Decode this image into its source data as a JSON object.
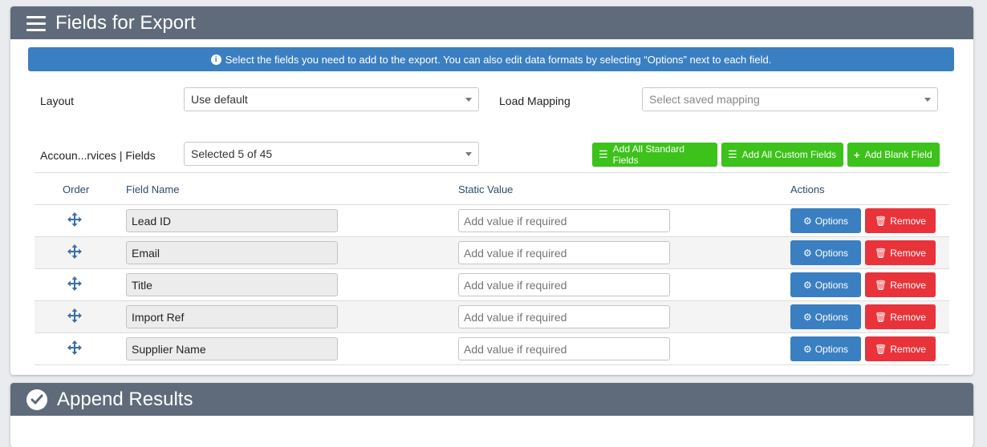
{
  "export_panel": {
    "title": "Fields for Export",
    "info": "Select the fields you need to add to the export. You can also edit data formats by selecting “Options” next to each field.",
    "layout_label": "Layout",
    "layout_value": "Use default",
    "load_mapping_label": "Load Mapping",
    "load_mapping_placeholder": "Select saved mapping",
    "fields_label": "Accoun...rvices | Fields",
    "fields_value": "Selected 5 of 45",
    "buttons": {
      "add_standard": "Add All Standard Fields",
      "add_custom": "Add All Custom Fields",
      "add_blank": "Add Blank Field"
    },
    "table": {
      "headers": {
        "order": "Order",
        "field_name": "Field Name",
        "static_value": "Static Value",
        "actions": "Actions"
      },
      "static_placeholder": "Add value if required",
      "options_label": "Options",
      "remove_label": "Remove",
      "rows": [
        {
          "field_name": "Lead ID"
        },
        {
          "field_name": "Email"
        },
        {
          "field_name": "Title"
        },
        {
          "field_name": "Import Ref"
        },
        {
          "field_name": "Supplier Name"
        }
      ]
    }
  },
  "append_panel": {
    "title": "Append Results"
  },
  "colors": {
    "header_bg": "#5f6b7a",
    "info_bg": "#3a7fc1",
    "green": "#3cc21a",
    "blue_button": "#3a7fc1",
    "red_button": "#e8333b"
  }
}
